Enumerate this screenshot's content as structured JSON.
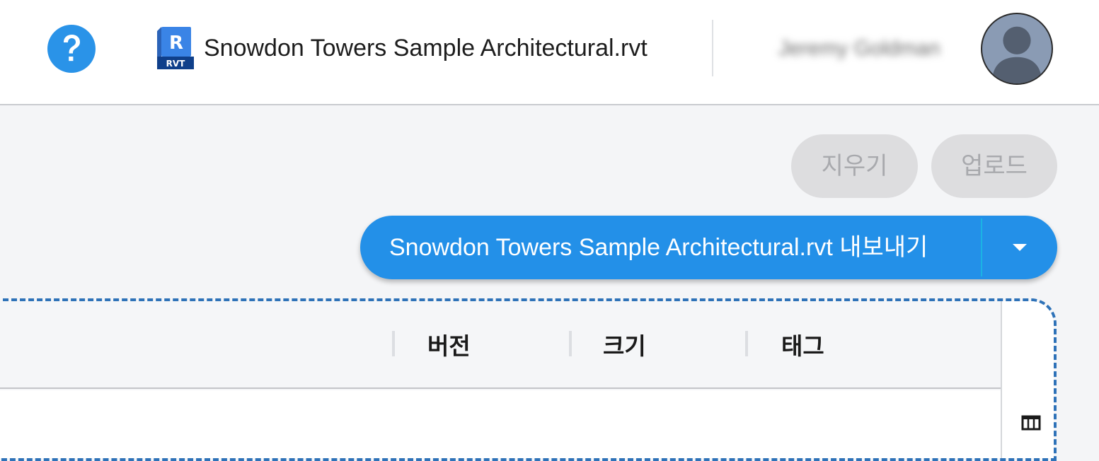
{
  "header": {
    "help_icon": "help-circle-icon",
    "file_icon_letter": "R",
    "file_icon_badge": "RVT",
    "file_title": "Snowdon Towers Sample Architectural.rvt",
    "user_name": "Jeremy Goldman",
    "avatar_icon": "user-silhouette-icon"
  },
  "actions": {
    "clear_label": "지우기",
    "upload_label": "업로드",
    "export_label": "Snowdon Towers Sample Architectural.rvt 내보내기",
    "export_dropdown_icon": "caret-down-icon"
  },
  "table": {
    "columns": [
      "버전",
      "크기",
      "태그"
    ],
    "column_picker_icon": "columns-icon"
  },
  "colors": {
    "accent": "#2390e8",
    "help": "#2a93e8",
    "disabled_bg": "#dddddf",
    "disabled_text": "#a8a9ad",
    "dashed_border": "#2e72b8"
  }
}
